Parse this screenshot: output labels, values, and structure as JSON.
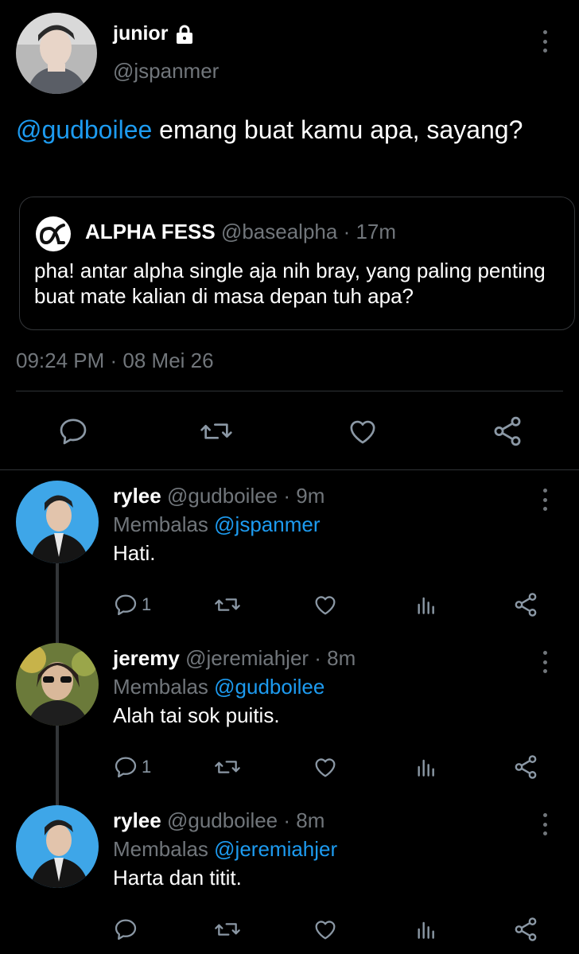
{
  "main_tweet": {
    "name": "junior",
    "handle": "@jspanmer",
    "text_mention": "@gudboilee",
    "text_body": " emang buat kamu apa, sayang?",
    "quote": {
      "name": "ALPHA FESS",
      "handle": "@basealpha",
      "time": " · 17m",
      "text": "pha! antar alpha single aja nih bray, yang paling penting buat mate kalian di masa depan tuh apa?"
    },
    "timestamp": "09:24 PM · 08 Mei 26",
    "actions": [
      "reply-icon",
      "retweet-icon",
      "like-icon",
      "share-icon"
    ]
  },
  "replies": [
    {
      "name": "rylee",
      "handle": "@gudboilee",
      "time": " · 9m",
      "reply_prefix": "Membalas ",
      "reply_to": "@jspanmer",
      "text": "Hati.",
      "reply_count": "1"
    },
    {
      "name": "jeremy",
      "handle": "@jeremiahjer",
      "time": " · 8m",
      "reply_prefix": "Membalas ",
      "reply_to": "@gudboilee",
      "text": "Alah tai sok puitis.",
      "reply_count": "1"
    },
    {
      "name": "rylee",
      "handle": "@gudboilee",
      "time": " · 8m",
      "reply_prefix": "Membalas ",
      "reply_to": "@jeremiahjer",
      "text": "Harta dan titit.",
      "reply_count": ""
    }
  ],
  "colors": {
    "background": "#000000",
    "text": "#e7e9ea",
    "muted": "#71767b",
    "link": "#1d9bf0",
    "border": "#2f3336"
  }
}
